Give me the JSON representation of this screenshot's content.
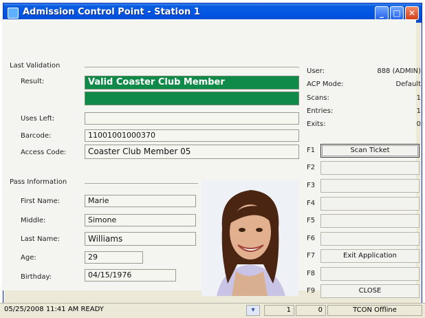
{
  "window": {
    "title": "Admission Control Point - Station 1"
  },
  "last_validation": {
    "section_label": "Last Validation",
    "result_label": "Result:",
    "result_value": "Valid Coaster Club Member",
    "uses_left_label": "Uses Left:",
    "uses_left_value": "",
    "barcode_label": "Barcode:",
    "barcode_value": "11001001000370",
    "access_code_label": "Access Code:",
    "access_code_value": "Coaster Club Member 05"
  },
  "pass_information": {
    "section_label": "Pass Information",
    "first_name_label": "First Name:",
    "first_name_value": "Marie",
    "middle_label": "Middle:",
    "middle_value": "Simone",
    "last_name_label": "Last Name:",
    "last_name_value": "Williams",
    "age_label": "Age:",
    "age_value": "29",
    "birthday_label": "Birthday:",
    "birthday_value": "04/15/1976"
  },
  "stats": {
    "user_label": "User:",
    "user_value": "888 (ADMIN)",
    "acp_mode_label": "ACP Mode:",
    "acp_mode_value": "Default",
    "scans_label": "Scans:",
    "scans_value": "1",
    "entries_label": "Entries:",
    "entries_value": "1",
    "exits_label": "Exits:",
    "exits_value": "0"
  },
  "function_keys": [
    {
      "key": "F1",
      "label": "Scan Ticket"
    },
    {
      "key": "F2",
      "label": ""
    },
    {
      "key": "F3",
      "label": ""
    },
    {
      "key": "F4",
      "label": ""
    },
    {
      "key": "F5",
      "label": ""
    },
    {
      "key": "F6",
      "label": ""
    },
    {
      "key": "F7",
      "label": "Exit Application"
    },
    {
      "key": "F8",
      "label": ""
    },
    {
      "key": "F9",
      "label": "CLOSE"
    }
  ],
  "statusbar": {
    "datetime_status": "05/25/2008 11:41 AM  READY",
    "count1": "1",
    "count2": "0",
    "connection": "TCON Offline"
  },
  "colors": {
    "result_green": "#108a48",
    "titlebar_blue": "#0054e3"
  }
}
